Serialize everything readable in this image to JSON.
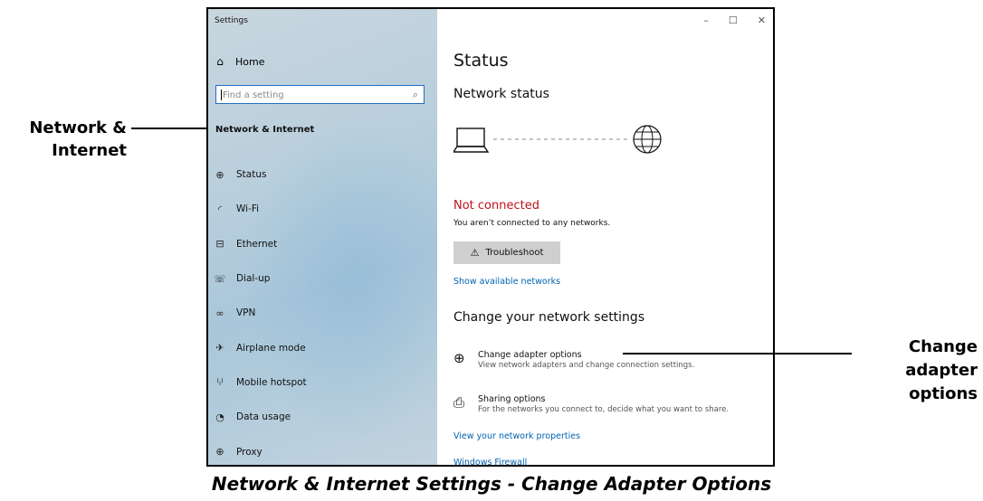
{
  "window": {
    "title": "Settings",
    "controls": {
      "minimize": "–",
      "maximize": "☐",
      "close": "✕"
    }
  },
  "sidebar": {
    "home": {
      "label": "Home",
      "icon": "home-icon"
    },
    "search": {
      "placeholder": "Find a setting",
      "icon": "search-icon"
    },
    "section": "Network & Internet",
    "items": [
      {
        "label": "Status",
        "icon": "globe-icon"
      },
      {
        "label": "Wi-Fi",
        "icon": "wifi-icon"
      },
      {
        "label": "Ethernet",
        "icon": "ethernet-icon"
      },
      {
        "label": "Dial-up",
        "icon": "dialup-icon"
      },
      {
        "label": "VPN",
        "icon": "vpn-icon"
      },
      {
        "label": "Airplane mode",
        "icon": "airplane-icon"
      },
      {
        "label": "Mobile hotspot",
        "icon": "hotspot-icon"
      },
      {
        "label": "Data usage",
        "icon": "data-usage-icon"
      },
      {
        "label": "Proxy",
        "icon": "proxy-globe-icon"
      }
    ]
  },
  "main": {
    "title": "Status",
    "network_status_heading": "Network status",
    "status_text": "Not connected",
    "status_desc": "You aren’t connected to any networks.",
    "troubleshoot_label": "Troubleshoot",
    "show_networks_link": "Show available networks",
    "change_heading": "Change your network settings",
    "options": [
      {
        "title": "Change adapter options",
        "desc": "View network adapters and change connection settings.",
        "icon": "adapter-icon"
      },
      {
        "title": "Sharing options",
        "desc": "For the networks you connect to, decide what you want to share.",
        "icon": "sharing-icon"
      }
    ],
    "view_properties_link": "View your network properties",
    "firewall_link": "Windows Firewall"
  },
  "annotations": {
    "left": [
      "Network &",
      "Internet"
    ],
    "right": [
      "Change",
      "adapter",
      "options"
    ]
  },
  "caption": "Network & Internet Settings - Change Adapter Options",
  "colors": {
    "accent": "#0063b1",
    "error": "#c0101f",
    "search_border": "#1f6fc0",
    "button": "#cfcfcf"
  }
}
